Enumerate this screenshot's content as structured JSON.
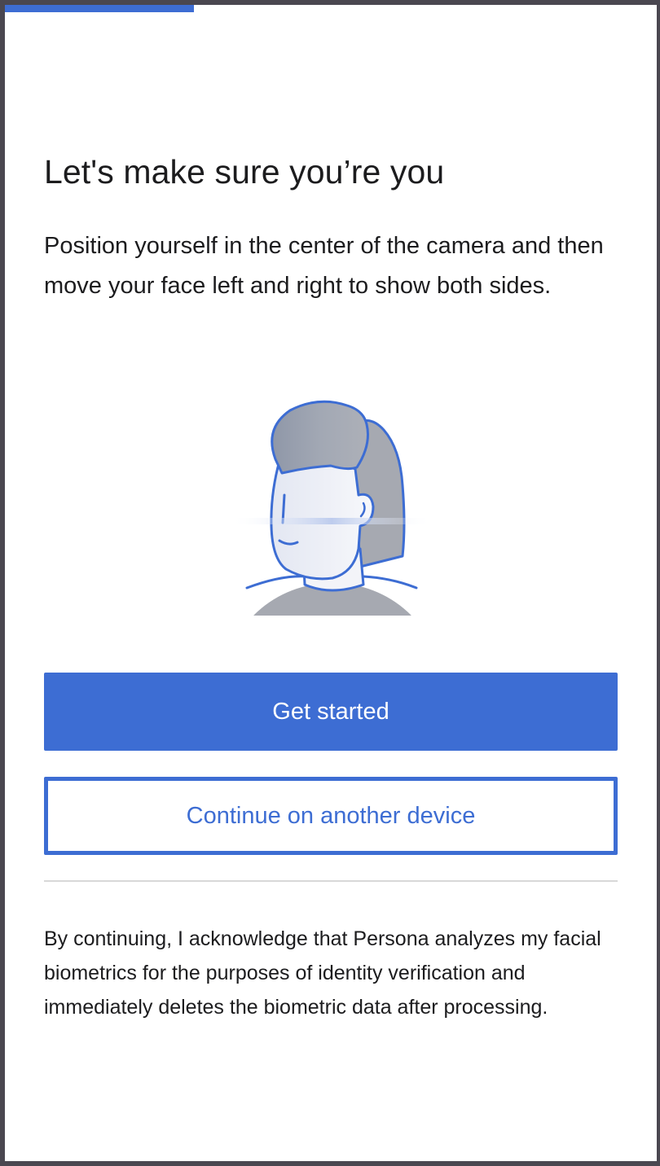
{
  "progress": {
    "fraction": 0.29
  },
  "header": {
    "title": "Let's make sure you’re you"
  },
  "instructions": "Position yourself in the center of the camera and then move your face left and right to show both sides.",
  "illustration": {
    "icon": "face-scan-icon",
    "accent_color": "#3d6dd3"
  },
  "buttons": {
    "primary_label": "Get started",
    "secondary_label": "Continue on another device"
  },
  "disclaimer": "By continuing, I acknowledge that Persona analyzes my facial biometrics for the purposes of identity verification and immediately deletes the biometric data after processing.",
  "colors": {
    "accent": "#3d6dd3",
    "text": "#1c1c1e",
    "divider": "#d8d8d8"
  }
}
